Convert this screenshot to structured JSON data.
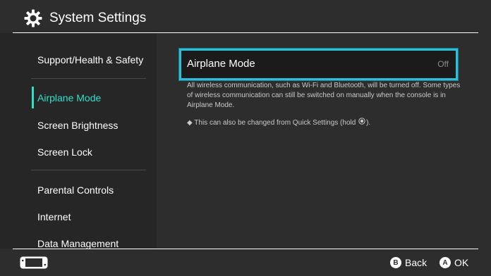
{
  "header": {
    "title": "System Settings",
    "icon": "gear-icon"
  },
  "sidebar": {
    "items": [
      {
        "label": "Support/Health & Safety"
      },
      {
        "label": "Airplane Mode",
        "selected": true
      },
      {
        "label": "Screen Brightness"
      },
      {
        "label": "Screen Lock"
      },
      {
        "label": "Parental Controls"
      },
      {
        "label": "Internet"
      },
      {
        "label": "Data Management"
      }
    ]
  },
  "main": {
    "setting": {
      "label": "Airplane Mode",
      "value": "Off"
    },
    "description": "All wireless communication, such as Wi-Fi and Bluetooth, will be turned off. Some types of wireless communication can still be switched on manually when the console is in Airplane Mode.",
    "note_prefix": "◆ This can also be changed from Quick Settings (hold",
    "note_suffix": ")."
  },
  "footer": {
    "buttons": [
      {
        "glyph": "B",
        "label": "Back"
      },
      {
        "glyph": "A",
        "label": "OK"
      }
    ]
  },
  "colors": {
    "accent": "#2fe0c9",
    "focus_border": "#2dbfd7",
    "background": "#2d2d2d",
    "sidebar": "#262626"
  }
}
